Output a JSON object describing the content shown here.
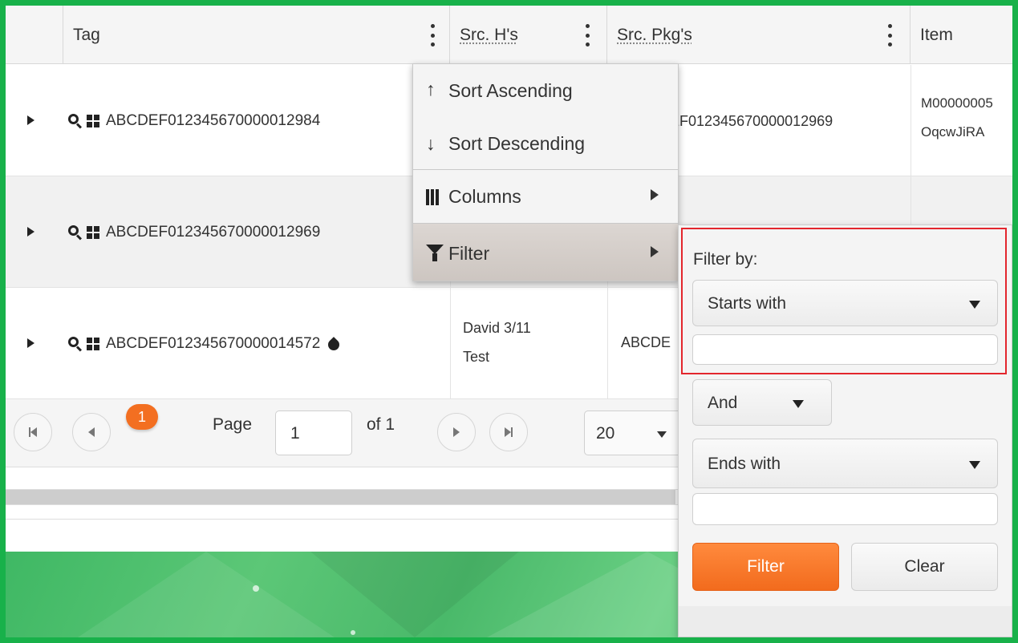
{
  "grid": {
    "columns": [
      {
        "label": "Tag"
      },
      {
        "label": "Src. H's"
      },
      {
        "label": "Src. Pkg's"
      },
      {
        "label": "Item"
      }
    ],
    "rows": [
      {
        "tag": "ABCDEF012345670000012984",
        "src_h": "",
        "src_pkg": "ABCDEF012345670000012969",
        "src_pkg_visible": "EF012345670000012969",
        "item_line1": "M00000005",
        "item_line2": "OqcwJiRA"
      },
      {
        "tag": "ABCDEF012345670000012969",
        "src_h": "",
        "src_pkg": "",
        "item_line1": "",
        "item_line2": ""
      },
      {
        "tag": "ABCDEF012345670000014572",
        "src_h_line1": "David 3/11",
        "src_h_line2": "Test",
        "src_pkg_visible": "ABCDE",
        "item_line1": "",
        "item_line2": ""
      }
    ]
  },
  "pager": {
    "current_page_badge": "1",
    "page_label": "Page",
    "page_value": "1",
    "of_label": "of 1",
    "page_size": "20"
  },
  "column_menu": {
    "sort_ascending": "Sort Ascending",
    "sort_descending": "Sort Descending",
    "columns": "Columns",
    "filter": "Filter",
    "icons": {
      "asc": "↑",
      "desc": "↓"
    }
  },
  "filter_panel": {
    "filter_by_label": "Filter by:",
    "operator1": "Starts with",
    "value1": "",
    "logic": "And",
    "operator2": "Ends with",
    "value2": "",
    "filter_button": "Filter",
    "clear_button": "Clear"
  },
  "colors": {
    "accent_orange": "#f36f21",
    "frame_green": "#18b14a",
    "highlight_red": "#e3262d"
  }
}
